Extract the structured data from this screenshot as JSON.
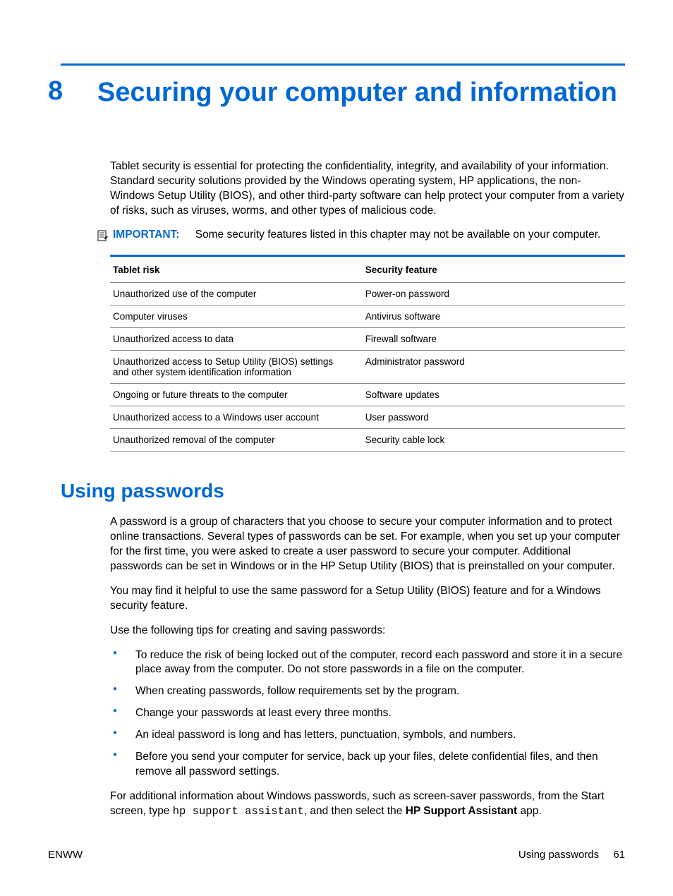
{
  "chapter": {
    "number": "8",
    "title": "Securing your computer and information"
  },
  "intro": "Tablet security is essential for protecting the confidentiality, integrity, and availability of your information. Standard security solutions provided by the Windows operating system, HP applications, the non-Windows Setup Utility (BIOS), and other third-party software can help protect your computer from a variety of risks, such as viruses, worms, and other types of malicious code.",
  "important": {
    "label": "IMPORTANT:",
    "text": "Some security features listed in this chapter may not be available on your computer."
  },
  "table": {
    "headers": [
      "Tablet risk",
      "Security feature"
    ],
    "rows": [
      [
        "Unauthorized use of the computer",
        "Power-on password"
      ],
      [
        "Computer viruses",
        "Antivirus software"
      ],
      [
        "Unauthorized access to data",
        "Firewall software"
      ],
      [
        "Unauthorized access to Setup Utility (BIOS) settings and other system identification information",
        "Administrator password"
      ],
      [
        "Ongoing or future threats to the computer",
        "Software updates"
      ],
      [
        "Unauthorized access to a Windows user account",
        "User password"
      ],
      [
        "Unauthorized removal of the computer",
        "Security cable lock"
      ]
    ]
  },
  "section": {
    "heading": "Using passwords",
    "p1": "A password is a group of characters that you choose to secure your computer information and to protect online transactions. Several types of passwords can be set. For example, when you set up your computer for the first time, you were asked to create a user password to secure your computer. Additional passwords can be set in Windows or in the HP Setup Utility (BIOS) that is preinstalled on your computer.",
    "p2": "You may find it helpful to use the same password for a Setup Utility (BIOS) feature and for a Windows security feature.",
    "p3": "Use the following tips for creating and saving passwords:",
    "tips": [
      "To reduce the risk of being locked out of the computer, record each password and store it in a secure place away from the computer. Do not store passwords in a file on the computer.",
      "When creating passwords, follow requirements set by the program.",
      "Change your passwords at least every three months.",
      "An ideal password is long and has letters, punctuation, symbols, and numbers.",
      "Before you send your computer for service, back up your files, delete confidential files, and then remove all password settings."
    ],
    "p4_pre": "For additional information about Windows passwords, such as screen-saver passwords, from the Start screen, type ",
    "p4_mono": "hp support assistant",
    "p4_mid": ", and then select the ",
    "p4_bold": "HP Support Assistant",
    "p4_post": " app."
  },
  "footer": {
    "left": "ENWW",
    "right_label": "Using passwords",
    "page": "61"
  }
}
